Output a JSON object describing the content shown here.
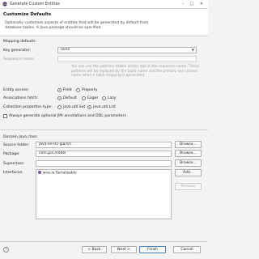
{
  "window": {
    "title": "Generate Custom Entities",
    "minimize_glyph": "–",
    "maximize_glyph": "□",
    "close_glyph": "✕"
  },
  "header": {
    "title": "Customize Defaults",
    "description": "Optionally customize aspects of entities that will be generated by default from database tables. A Java package should be specified."
  },
  "mapping": {
    "section_label": "Mapping defaults",
    "key_generator_label": "Key generator:",
    "key_generator_value": "none",
    "sequence_name_label": "Sequence name:",
    "sequence_hint": "You can use the patterns $table and/or $pk in the sequence name. These patterns will be replaced by the table name and the primary key column name when a table mapping is generated.",
    "entity_access_label": "Entity access:",
    "entity_access_options": [
      "Field",
      "Property"
    ],
    "associations_fetch_label": "Associations fetch:",
    "associations_fetch_options": [
      "Default",
      "Eager",
      "Lazy"
    ],
    "collection_type_label": "Collection properties type:",
    "collection_type_options": [
      "java.util.Set",
      "java.util.List"
    ],
    "always_generate_label": "Always generate optional JPA annotations and DDL parameters"
  },
  "domain": {
    "section_label": "Domain java class",
    "source_folder_label": "Source folder:",
    "source_folder_value": "java-ee-01-jpa/src",
    "package_label": "Package:",
    "package_value": "com.jpa.model",
    "superclass_label": "Superclass:",
    "superclass_value": "",
    "interfaces_label": "Interfaces:",
    "interfaces": [
      "java.io.Serializable"
    ],
    "browse_label": "Browse...",
    "add_label": "Add...",
    "remove_label": "Remove"
  },
  "footer": {
    "help_glyph": "?",
    "back_label": "< Back",
    "next_label": "Next >",
    "finish_label": "Finish",
    "cancel_label": "Cancel"
  }
}
